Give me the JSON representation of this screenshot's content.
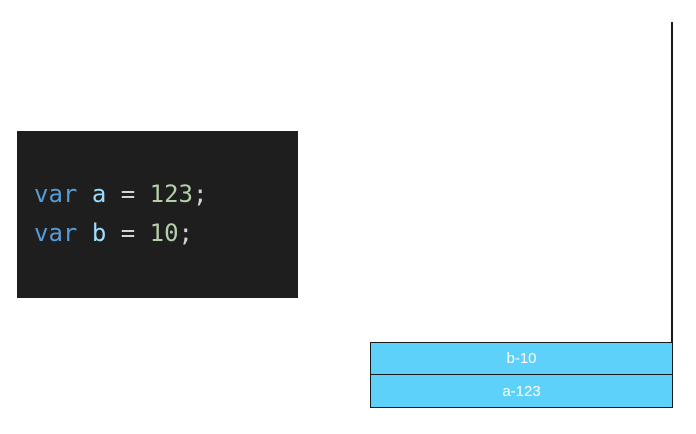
{
  "code": {
    "lines": [
      {
        "keyword": "var",
        "name": "a",
        "op": "=",
        "value": "123",
        "end": ";"
      },
      {
        "keyword": "var",
        "name": "b",
        "op": "=",
        "value": "10",
        "end": ";"
      }
    ],
    "colors": {
      "background": "#1e1e1e",
      "keyword": "#569cd6",
      "identifier": "#9cdcfe",
      "number": "#b5cea8",
      "punctuation": "#d4d4d4"
    }
  },
  "stack": {
    "cells": [
      {
        "label": "b-10"
      },
      {
        "label": "a-123"
      }
    ],
    "colors": {
      "cell": "#5ed1fb",
      "text": "#ffffff",
      "border": "#1a1a1a"
    }
  }
}
